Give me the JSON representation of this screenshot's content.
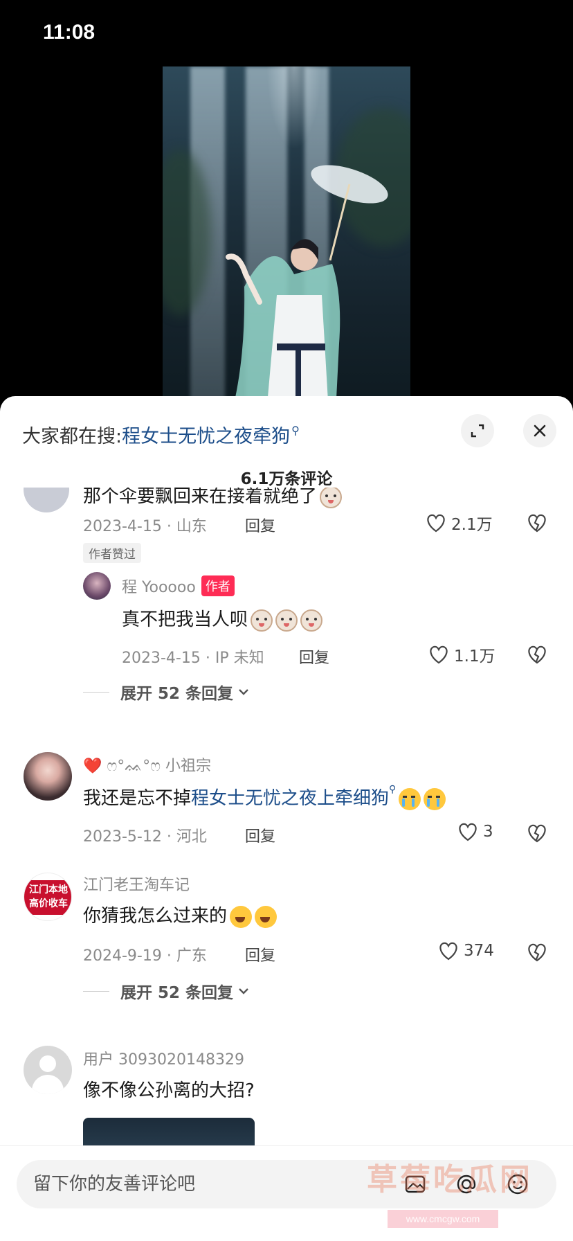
{
  "status": {
    "time": "11:08"
  },
  "search_hint": {
    "prefix": "大家都在搜:",
    "keyword": "程女士无忧之夜牵狗"
  },
  "comments_count": "6.1万条评论",
  "comments": [
    {
      "text": "那个伞要飘回来在接着就绝了",
      "date_location": "2023-4-15 · 山东",
      "reply": "回复",
      "likes": "2.1万",
      "tag": "作者赞过"
    },
    {
      "user": "程 Yooooo",
      "badge": "作者",
      "text": "真不把我当人呗",
      "date_location": "2023-4-15 · IP 未知",
      "reply": "回复",
      "likes": "1.1万",
      "expand": "展开 52 条回复"
    },
    {
      "user": "❤️ ෆ°ᨐ°ෆ 小祖宗",
      "text_prefix": "我还是忘不掉",
      "text_keyword": "程女士无忧之夜上牵细狗",
      "date_location": "2023-5-12 · 河北",
      "reply": "回复",
      "likes": "3"
    },
    {
      "user": "江门老王淘车记",
      "avatar_text": "江门本地\n高价收车",
      "text": "你猜我怎么过来的",
      "date_location": "2024-9-19 · 广东",
      "reply": "回复",
      "likes": "374",
      "expand": "展开 52 条回复"
    },
    {
      "user": "用户 3093020148329",
      "text": "像不像公孙离的大招?"
    }
  ],
  "input": {
    "placeholder": "留下你的友善评论吧"
  },
  "watermark": {
    "text": "草莓吃瓜网",
    "url": "www.cmcgw.com"
  },
  "icons": [
    "expand-icon",
    "close-icon",
    "heart-icon",
    "dislike-icon",
    "chevron-down-icon",
    "emoji-face-icon",
    "at-icon",
    "image-icon"
  ]
}
